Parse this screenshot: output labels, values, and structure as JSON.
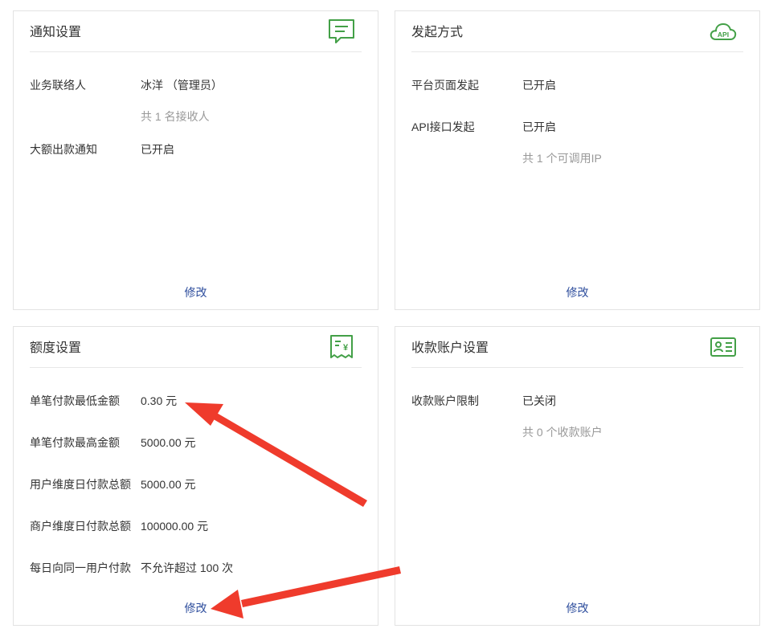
{
  "cards": {
    "notify": {
      "title": "通知设置",
      "icon": "message-icon",
      "rows": [
        {
          "label": "业务联络人",
          "value": "冰洋 （管理员）",
          "sub": "共 1 名接收人"
        },
        {
          "label": "大额出款通知",
          "value": "已开启"
        }
      ],
      "edit": "修改"
    },
    "launch": {
      "title": "发起方式",
      "icon": "cloud-api-icon",
      "icon_text": "API",
      "rows": [
        {
          "label": "平台页面发起",
          "value": "已开启"
        },
        {
          "label": "API接口发起",
          "value": "已开启",
          "sub": "共 1 个可调用IP"
        }
      ],
      "edit": "修改"
    },
    "quota": {
      "title": "额度设置",
      "icon": "receipt-yen-icon",
      "rows": [
        {
          "label": "单笔付款最低金额",
          "value": "0.30 元"
        },
        {
          "label": "单笔付款最高金额",
          "value": "5000.00 元"
        },
        {
          "label": "用户维度日付款总额",
          "value": "5000.00 元"
        },
        {
          "label": "商户维度日付款总额",
          "value": "100000.00 元"
        },
        {
          "label": "每日向同一用户付款",
          "value": "不允许超过 100 次"
        }
      ],
      "edit": "修改"
    },
    "account": {
      "title": "收款账户设置",
      "icon": "id-card-icon",
      "rows": [
        {
          "label": "收款账户限制",
          "value": "已关闭",
          "sub": "共 0 个收款账户"
        }
      ],
      "edit": "修改"
    }
  },
  "colors": {
    "icon_green": "#43a047",
    "link_blue": "#2c4c9c",
    "annotation_red": "#ef3b2c"
  }
}
